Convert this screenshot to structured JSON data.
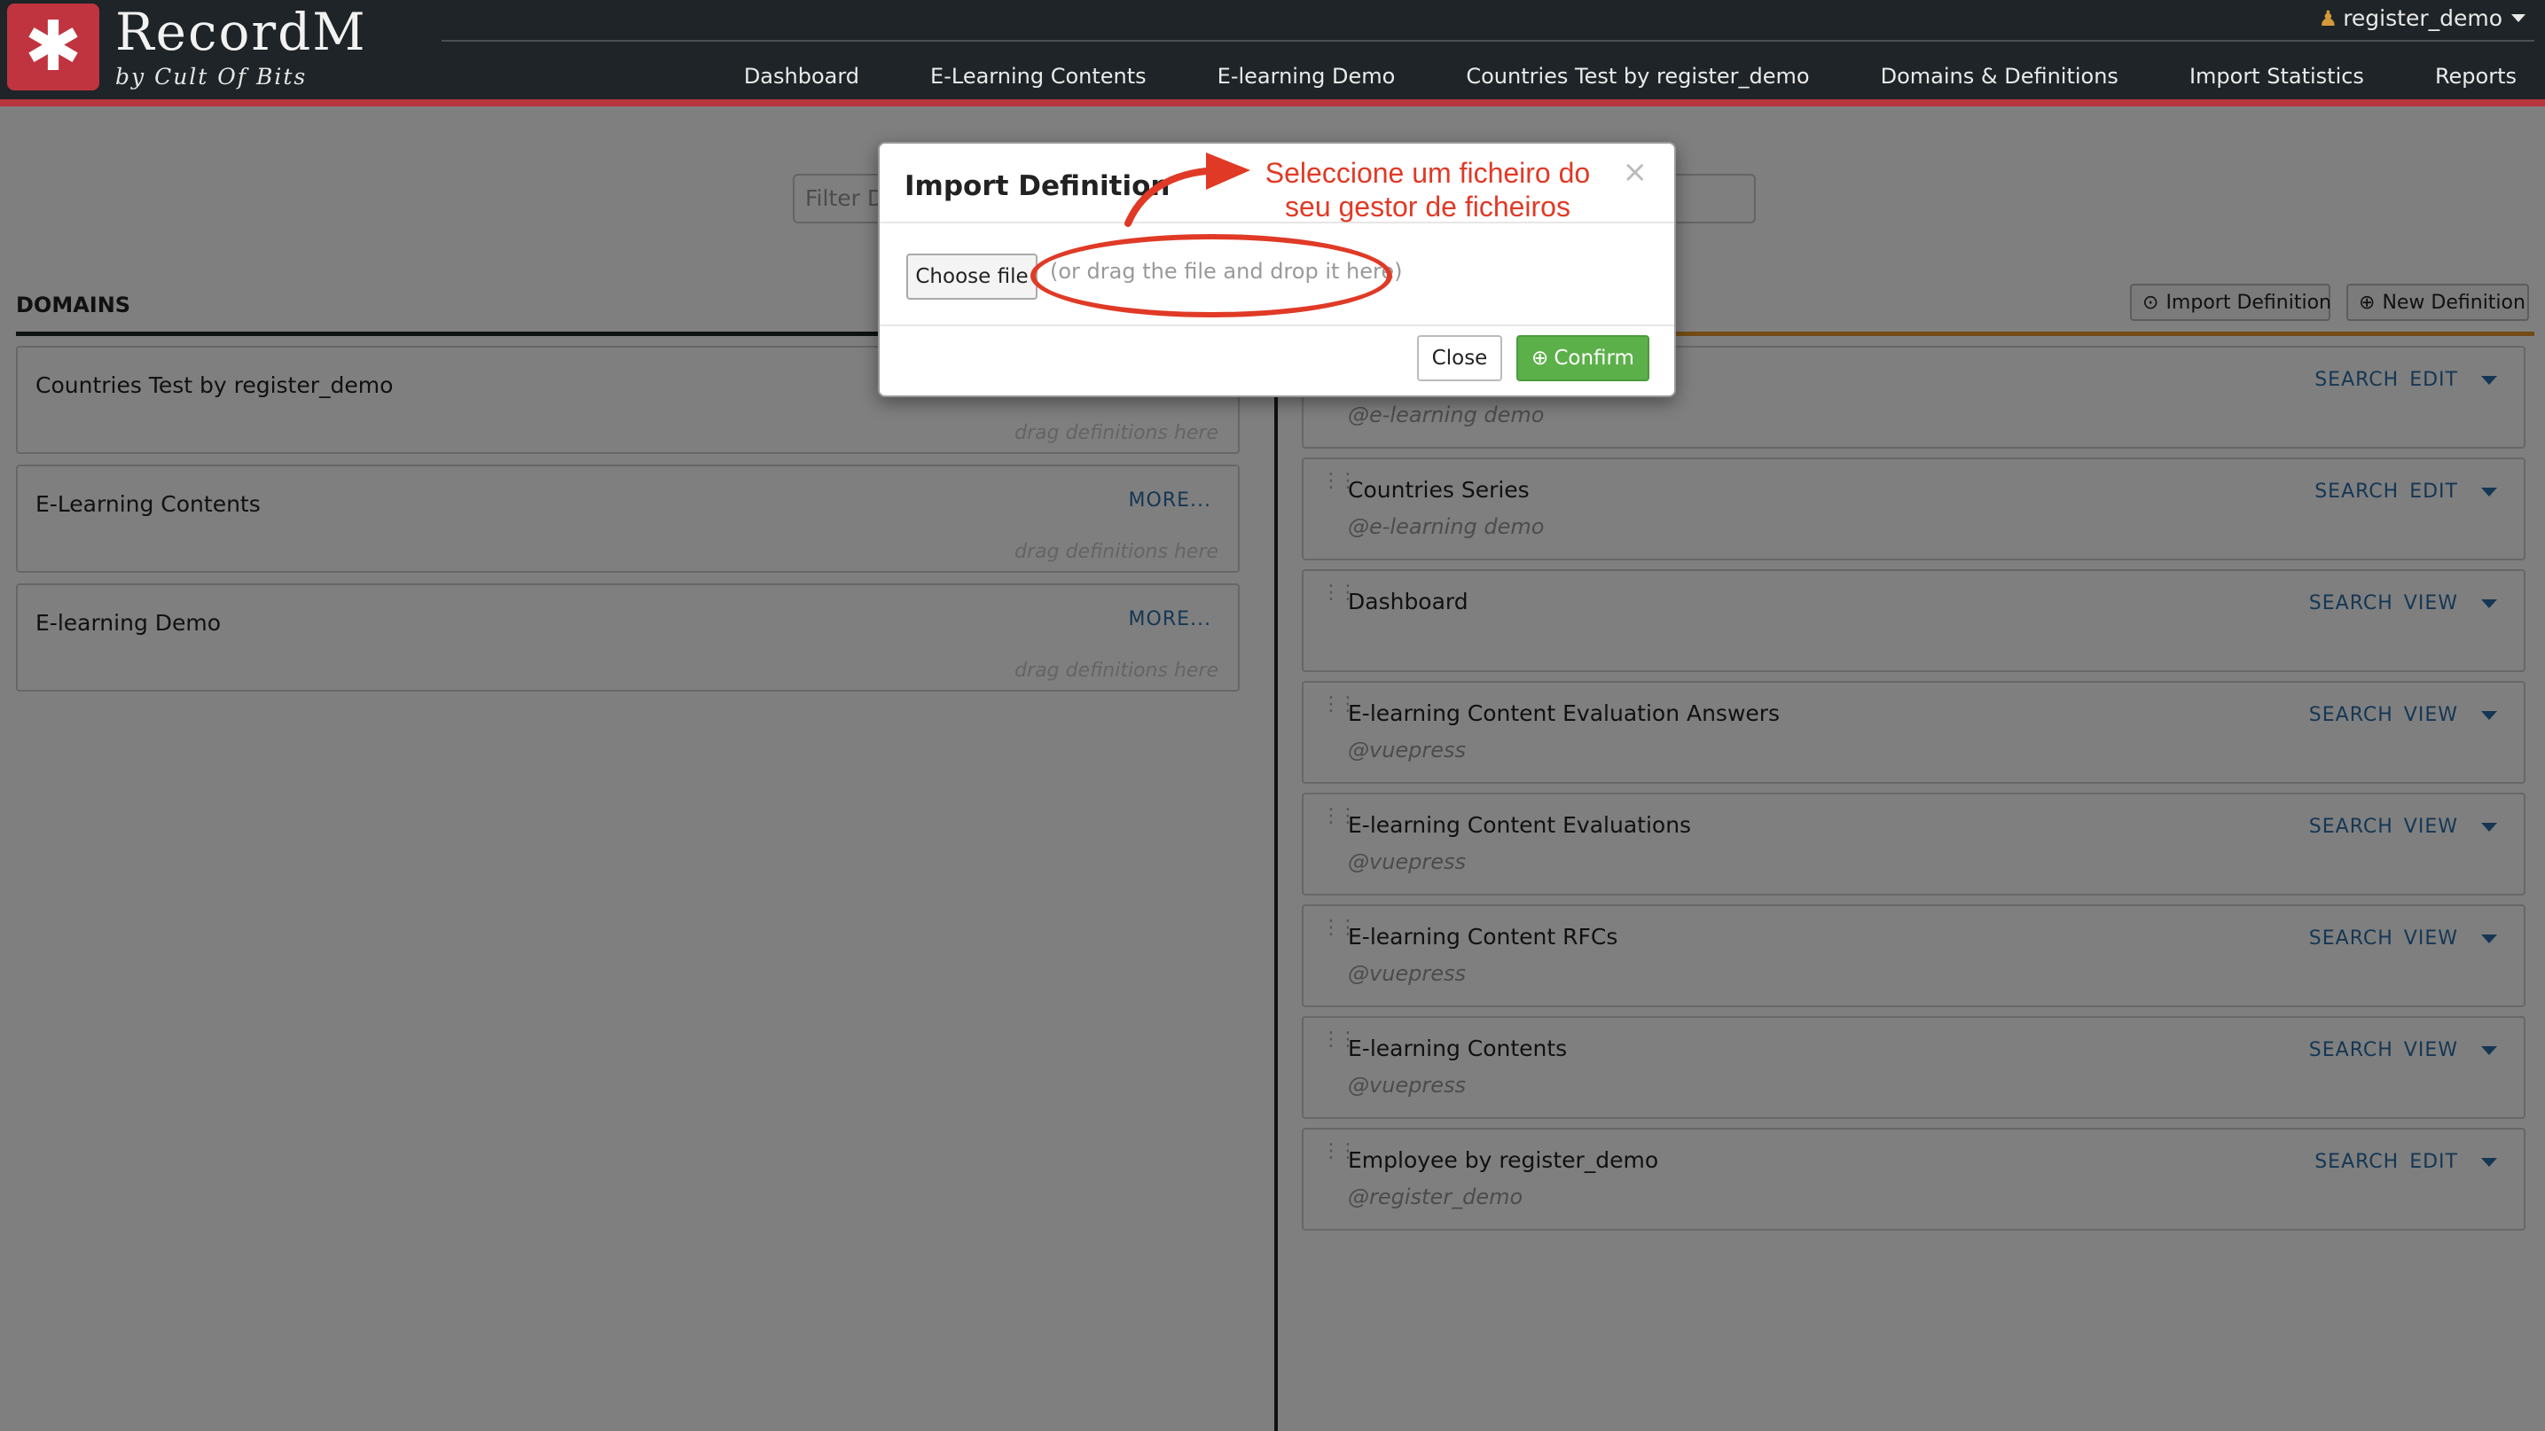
{
  "brand": {
    "logo_glyph": "✱",
    "name": "RecordM",
    "subtitle": "by Cult Of Bits",
    "accent_color": "#c0343f"
  },
  "user_menu": {
    "icon": "person-icon",
    "label": "register_demo"
  },
  "nav": {
    "items": [
      "Dashboard",
      "E-Learning Contents",
      "E-learning Demo",
      "Countries Test by register_demo",
      "Domains & Definitions",
      "Import Statistics",
      "Reports"
    ]
  },
  "filter": {
    "placeholder": "Filter D"
  },
  "domains": {
    "title": "DOMAINS",
    "more_label": "MORE...",
    "drop_hint": "drag definitions here",
    "items": [
      {
        "name": "Countries Test by register_demo",
        "has_more": false
      },
      {
        "name": "E-Learning Contents",
        "has_more": true
      },
      {
        "name": "E-learning Demo",
        "has_more": true
      }
    ]
  },
  "definitions": {
    "import_button": "Import Definition",
    "new_button": "New Definition",
    "search_label": "SEARCH",
    "items": [
      {
        "name": "",
        "namespace": "@e-learning demo",
        "action": "EDIT"
      },
      {
        "name": "Countries Series",
        "namespace": "@e-learning demo",
        "action": "EDIT"
      },
      {
        "name": "Dashboard",
        "namespace": "",
        "action": "VIEW"
      },
      {
        "name": "E-learning Content Evaluation Answers",
        "namespace": "@vuepress",
        "action": "VIEW"
      },
      {
        "name": "E-learning Content Evaluations",
        "namespace": "@vuepress",
        "action": "VIEW"
      },
      {
        "name": "E-learning Content RFCs",
        "namespace": "@vuepress",
        "action": "VIEW"
      },
      {
        "name": "E-learning Contents",
        "namespace": "@vuepress",
        "action": "VIEW"
      },
      {
        "name": "Employee by register_demo",
        "namespace": "@register_demo",
        "action": "EDIT"
      }
    ]
  },
  "modal": {
    "title": "Import Definition",
    "close_x": "×",
    "choose_file": "Choose file",
    "drop_hint": "(or drag the file and drop it here)",
    "close_button": "Close",
    "confirm_button": "Confirm",
    "confirm_color": "#5cb04a"
  },
  "annotation": {
    "line1": "Seleccione um ficheiro do",
    "line2": "seu gestor de ficheiros",
    "color": "#e03a26"
  }
}
